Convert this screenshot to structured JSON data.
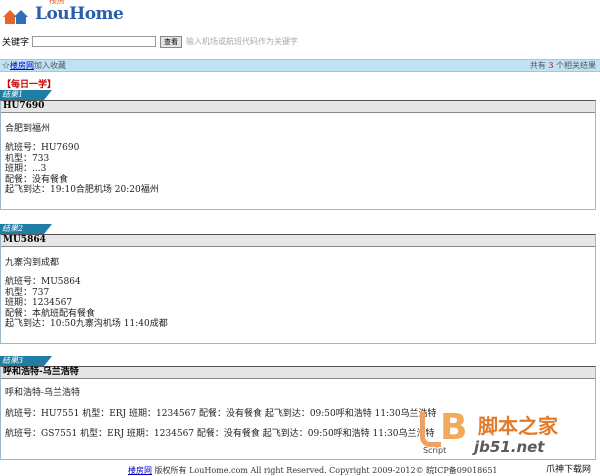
{
  "site": {
    "logo_cn": "楼房",
    "logo_en": "LouHome"
  },
  "search": {
    "label": "关键字",
    "value": "",
    "button": "查看",
    "hint": "输入机场或航班代码作为关键字"
  },
  "bar": {
    "fav_link": "楼房网",
    "fav_text": "加入收藏",
    "result_prefix": "共有",
    "result_count": "3",
    "result_suffix": "个相关结果"
  },
  "daily": "【每日一学】",
  "results": [
    {
      "tab": "结果1",
      "flight": "HU7690",
      "route": "合肥到福州",
      "lines": [
        "航班号：HU7690",
        "机型：733",
        "班期：...3",
        "配餐：没有餐食",
        "起飞到达：19:10合肥机场 20:20福州"
      ]
    },
    {
      "tab": "结果2",
      "flight": "MU5864",
      "route": "九寨沟到成都",
      "lines": [
        "航班号：MU5864",
        "机型：737",
        "班期：1234567",
        "配餐：本航班配有餐食",
        "起飞到达：10:50九寨沟机场 11:40成都"
      ]
    },
    {
      "tab": "结果3",
      "flight": "呼和浩特-乌兰浩特",
      "route": "呼和浩特-乌兰浩特",
      "lines": [
        "航班号：HU7551 机型：ERJ 班期：1234567 配餐：没有餐食 起飞到达：09:50呼和浩特 11:30乌兰浩特",
        "航班号：GS7551 机型：ERJ 班期：1234567 配餐：没有餐食 起飞到达：09:50呼和浩特 11:30乌兰浩特"
      ]
    }
  ],
  "footer": {
    "link": "楼房网",
    "text": "版权所有 LouHome.com All right Reserved. Copyright 2009-2012© 皖ICP备09018651"
  },
  "watermark": {
    "script": "Script",
    "site_cn": "脚本之家",
    "site_url": "jb51.net",
    "corner": "爪神下载网"
  }
}
